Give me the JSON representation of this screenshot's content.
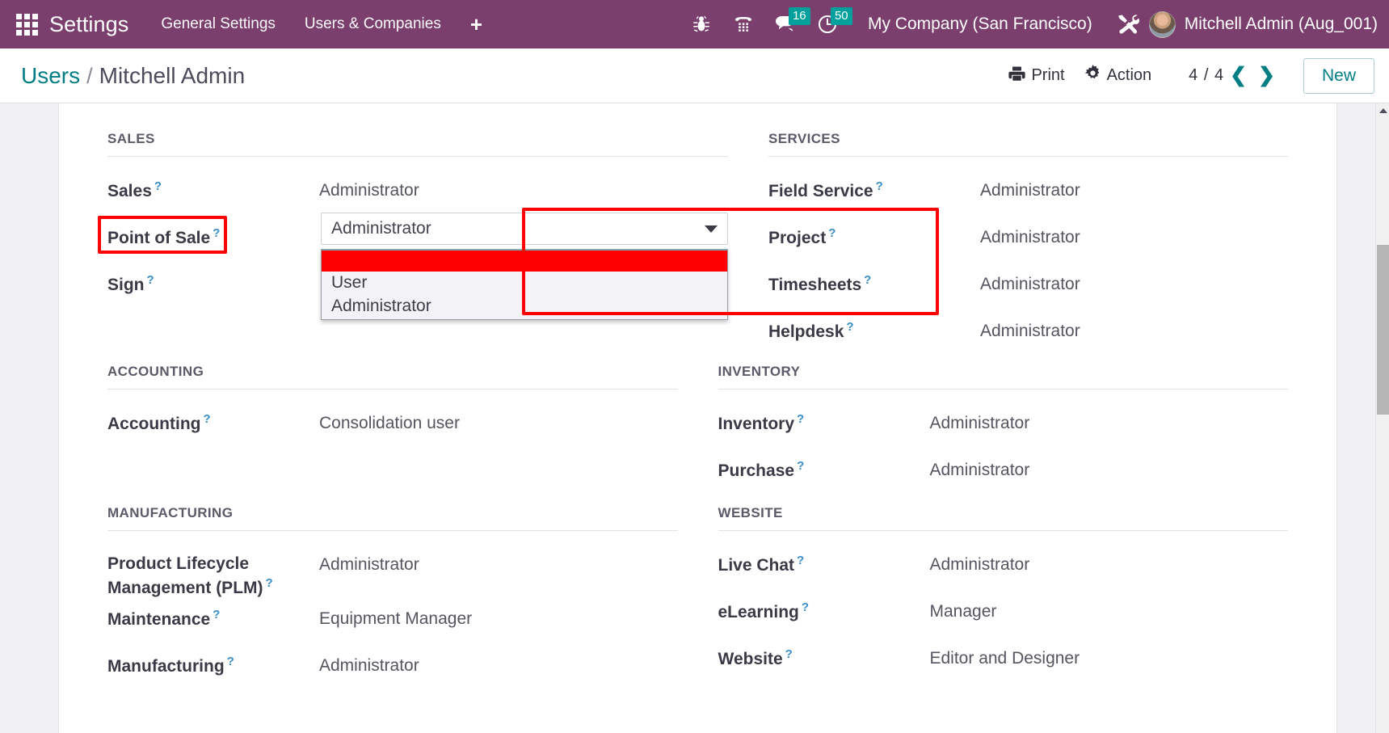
{
  "navbar": {
    "apps_icon": "apps-grid-icon",
    "brand": "Settings",
    "menus": [
      {
        "label": "General Settings"
      },
      {
        "label": "Users & Companies"
      }
    ],
    "plus_label": "+",
    "icons": [
      {
        "name": "bug-icon",
        "badge": null
      },
      {
        "name": "dialpad-icon",
        "badge": null
      },
      {
        "name": "messages-icon",
        "badge": "16"
      },
      {
        "name": "activities-clock-icon",
        "badge": "50"
      }
    ],
    "company": "My Company (San Francisco)",
    "tools_icon": "wrench-screwdriver-icon",
    "user": "Mitchell Admin (Aug_001)",
    "accent_purple": "#7b3f6e",
    "badge_color": "#00a09d"
  },
  "control_panel": {
    "breadcrumb_parent": "Users",
    "breadcrumb_sep": "/",
    "breadcrumb_current": "Mitchell Admin",
    "print_label": "Print",
    "action_label": "Action",
    "pager": "4 / 4",
    "prev_glyph": "❮",
    "next_glyph": "❯",
    "new_label": "New",
    "teal": "#017e84"
  },
  "form": {
    "sections": {
      "sales": {
        "title": "SALES",
        "fields": [
          {
            "label": "Sales",
            "value": "Administrator"
          },
          {
            "label": "Point of Sale",
            "value": "Administrator"
          },
          {
            "label": "Sign",
            "value": ""
          }
        ]
      },
      "services": {
        "title": "SERVICES",
        "fields": [
          {
            "label": "Field Service",
            "value": "Administrator"
          },
          {
            "label": "Project",
            "value": "Administrator"
          },
          {
            "label": "Timesheets",
            "value": "Administrator"
          },
          {
            "label": "Helpdesk",
            "value": "Administrator"
          }
        ]
      },
      "accounting": {
        "title": "ACCOUNTING",
        "fields": [
          {
            "label": "Accounting",
            "value": "Consolidation user"
          }
        ]
      },
      "inventory": {
        "title": "INVENTORY",
        "fields": [
          {
            "label": "Inventory",
            "value": "Administrator"
          },
          {
            "label": "Purchase",
            "value": "Administrator"
          }
        ]
      },
      "manufacturing": {
        "title": "MANUFACTURING",
        "fields": [
          {
            "label": "Product Lifecycle Management (PLM)",
            "value": "Administrator"
          },
          {
            "label": "Maintenance",
            "value": "Equipment Manager"
          },
          {
            "label": "Manufacturing",
            "value": "Administrator"
          }
        ]
      },
      "website": {
        "title": "WEBSITE",
        "fields": [
          {
            "label": "Live Chat",
            "value": "Administrator"
          },
          {
            "label": "eLearning",
            "value": "Manager"
          },
          {
            "label": "Website",
            "value": "Editor and Designer"
          }
        ]
      }
    },
    "help_glyph": "?"
  },
  "pos_dropdown": {
    "selected": "Administrator",
    "options": [
      {
        "label": "",
        "highlighted": true
      },
      {
        "label": "User",
        "highlighted": false
      },
      {
        "label": "Administrator",
        "highlighted": false
      }
    ],
    "highlight_color": "#ff0000"
  }
}
